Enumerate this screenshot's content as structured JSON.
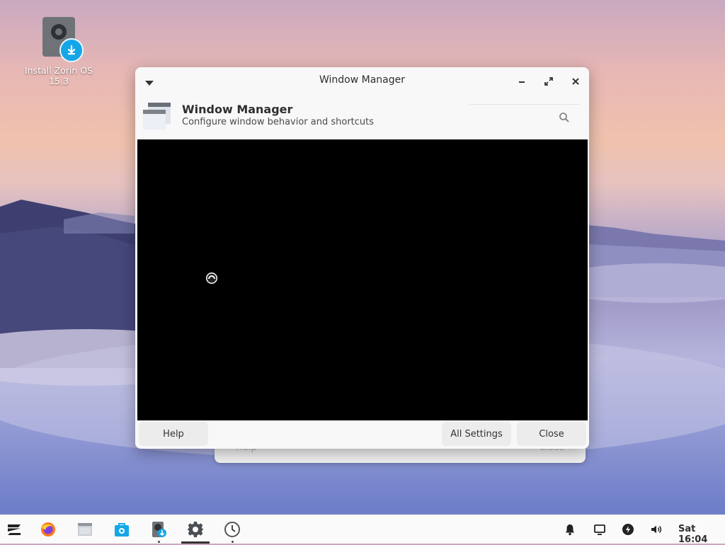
{
  "desktop": {
    "icon_name": "install-zorin-drive-icon",
    "label_line1": "Install Zorin OS",
    "label_line2": "15.3"
  },
  "window": {
    "title": "Window Manager",
    "header_title": "Window Manager",
    "header_subtitle": "Configure window behavior and shortcuts",
    "buttons": {
      "help": "Help",
      "all_settings": "All Settings",
      "close": "Close"
    }
  },
  "background_window": {
    "help_ghost": "Help",
    "close_ghost": "Close"
  },
  "taskbar": {
    "apps": [
      "zorin-menu-icon",
      "firefox-icon",
      "files-icon",
      "software-store-icon",
      "installer-icon",
      "settings-icon",
      "clock-app-icon"
    ],
    "tray": [
      "notifications-bell-icon",
      "display-icon",
      "power-icon",
      "volume-icon"
    ],
    "clock": "Sat 16:04"
  },
  "colors": {
    "accent": "#15a6e8",
    "window_bg": "#f8f8f8",
    "content_bg": "#000000",
    "taskbar_bg": "#fafafa"
  }
}
